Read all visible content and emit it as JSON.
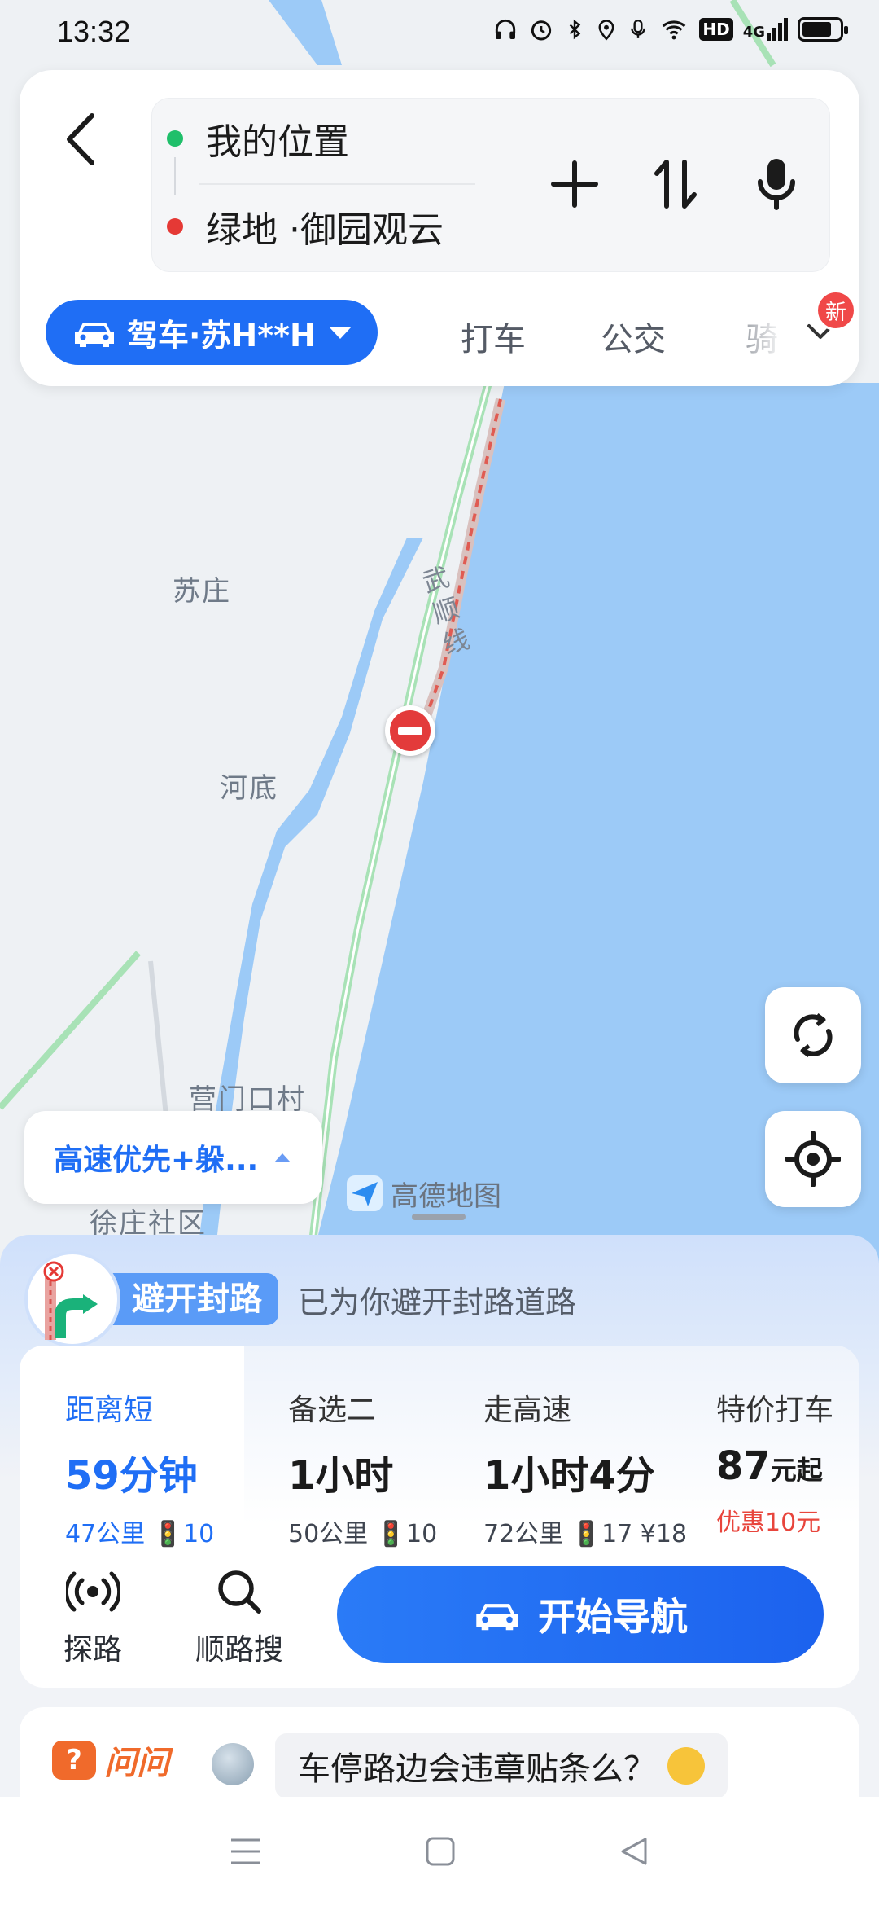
{
  "status_bar": {
    "time": "13:32",
    "icons": [
      "headphones-icon",
      "alarm-icon",
      "bluetooth-icon",
      "location-icon",
      "mic-icon",
      "wifi-icon",
      "hd-icon",
      "signal-4g-icon",
      "battery-icon"
    ],
    "hd_label": "HD",
    "network_label": "4G"
  },
  "route_input": {
    "origin": "我的位置",
    "destination": "绿地 ·御园观云",
    "origin_color": "#1fbf6a",
    "destination_color": "#e53935"
  },
  "modes": {
    "active": "驾车·苏H**H",
    "tabs": [
      "打车",
      "公交",
      "骑"
    ],
    "new_badge": "新",
    "accent": "#1f6ef5"
  },
  "map": {
    "labels": {
      "suzhuang": "苏庄",
      "hedi": "河底",
      "yingmenkou": "营门口村",
      "community": "徐庄社区"
    },
    "road_name": "武顺线",
    "brand": "高德地图"
  },
  "route_pref": {
    "label": "高速优先+躲..."
  },
  "avoid": {
    "tag": "避开封路",
    "message": "已为你避开封路道路"
  },
  "routes": [
    {
      "name": "距离短",
      "duration": "59分钟",
      "meta": "47公里 🚦10"
    },
    {
      "name": "备选二",
      "duration": "1小时",
      "meta": "50公里 🚦10"
    },
    {
      "name": "走高速",
      "duration": "1小时4分",
      "meta": "72公里 🚦17 ¥18"
    },
    {
      "name": "特价打车",
      "price": "87",
      "price_unit": "元起",
      "promo": "优惠10元"
    }
  ],
  "tools": {
    "explore": "探路",
    "search_along": "顺路搜"
  },
  "start_nav": "开始导航",
  "qa": {
    "brand": "问问",
    "question": "车停路边会违章贴条么？"
  }
}
